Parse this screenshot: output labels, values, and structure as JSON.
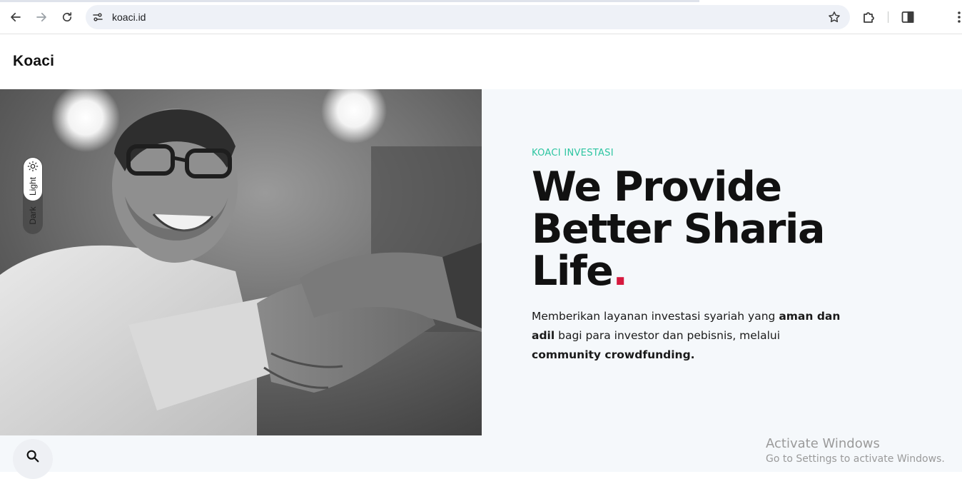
{
  "browser": {
    "url": "koaci.id",
    "icons": {
      "back": "arrow-left-icon",
      "forward": "arrow-right-icon",
      "reload": "reload-icon",
      "site_info": "tune-icon",
      "bookmark": "star-icon",
      "extensions": "puzzle-icon",
      "side_panel": "side-panel-icon",
      "menu": "more-vert-icon"
    }
  },
  "site": {
    "logo": "Koaci"
  },
  "theme_toggle": {
    "light_label": "Light",
    "dark_label": "Dark",
    "selected": "Light"
  },
  "hero": {
    "eyebrow": "KOACI INVESTASI",
    "headline_line1": "We Provide",
    "headline_line2": "Better Sharia",
    "headline_line3": "Life",
    "headline_dot": ".",
    "lead_part1": "Memberikan layanan investasi syariah yang ",
    "lead_bold1": "aman dan adil",
    "lead_part2": " bagi para investor dan pebisnis, melalui ",
    "lead_bold2": "community crowdfunding."
  },
  "windows_watermark": {
    "line1": "Activate Windows",
    "line2": "Go to Settings to activate Windows."
  },
  "colors": {
    "accent_teal": "#2dc5a1",
    "accent_red": "#d6193e",
    "hero_bg": "#f5f8fb"
  }
}
